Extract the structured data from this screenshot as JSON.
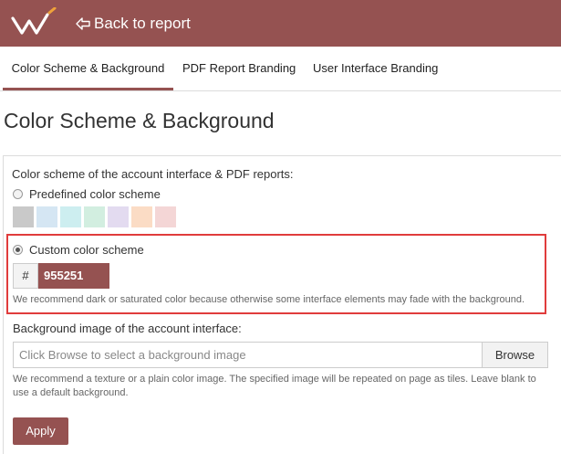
{
  "header": {
    "back_label": "Back to report",
    "brand_color": "#955251"
  },
  "tabs": [
    {
      "label": "Color Scheme & Background",
      "active": true
    },
    {
      "label": "PDF Report Branding",
      "active": false
    },
    {
      "label": "User Interface Branding",
      "active": false
    }
  ],
  "page_title": "Color Scheme & Background",
  "color_scheme": {
    "label": "Color scheme of the account interface & PDF reports:",
    "predefined_label": "Predefined color scheme",
    "predefined_selected": false,
    "swatches": [
      "#c9c9c9",
      "#d5e6f3",
      "#cdeef0",
      "#d2eee0",
      "#e3dbf0",
      "#fbdcc5",
      "#f4d6d6"
    ],
    "custom_label": "Custom color scheme",
    "custom_selected": true,
    "hex_prefix": "#",
    "hex_value": "955251",
    "hint": "We recommend dark or saturated color because otherwise some interface elements may fade with the background."
  },
  "background": {
    "label": "Background image of the account interface:",
    "placeholder": "Click Browse to select a background image",
    "browse_label": "Browse",
    "hint": "We recommend a texture or a plain color image. The specified image will be repeated on page as tiles. Leave blank to use a default background."
  },
  "apply_label": "Apply",
  "icons": {
    "logo": "logo-w",
    "back": "back-arrow-icon"
  }
}
